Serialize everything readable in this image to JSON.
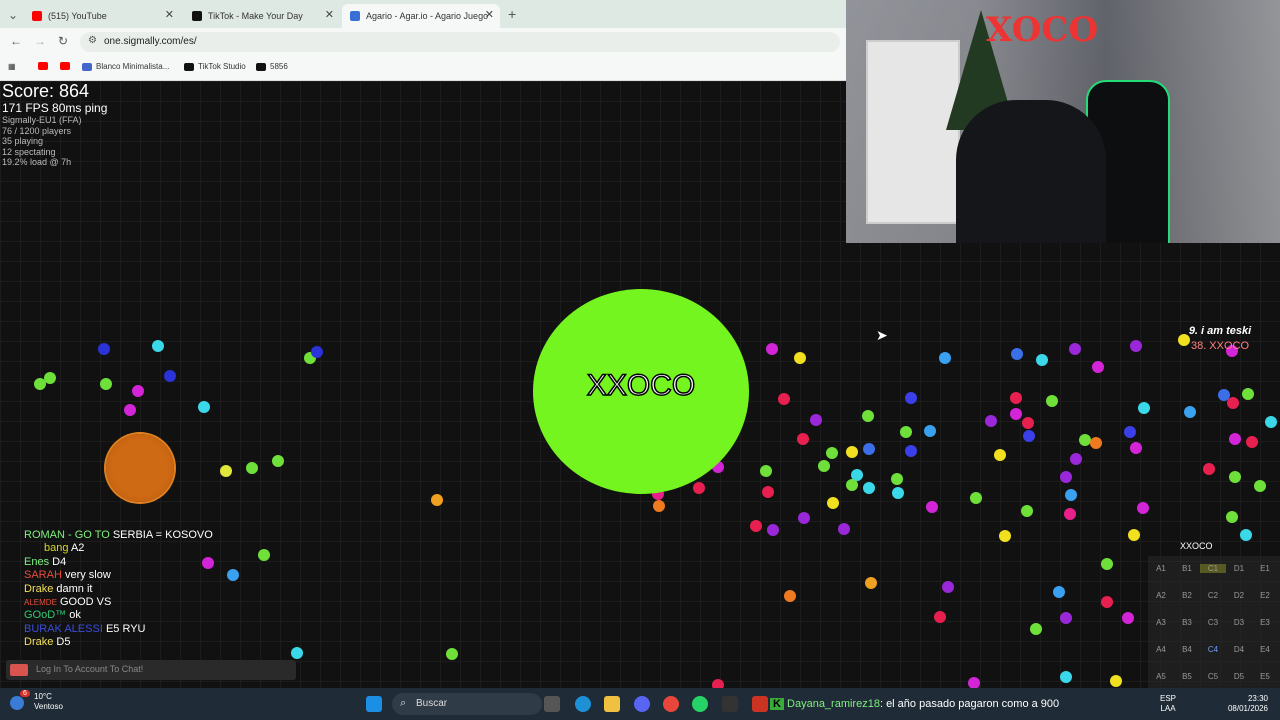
{
  "browser": {
    "tabs": [
      {
        "title": "(515) YouTube",
        "icon": "youtube-icon",
        "color": "#ff0000"
      },
      {
        "title": "TikTok - Make Your Day",
        "icon": "tiktok-icon",
        "color": "#111111"
      },
      {
        "title": "Agario - Agar.io - Agario Juego",
        "icon": "agario-icon",
        "color": "#3a6fd8"
      }
    ],
    "url": "one.sigmally.com/es/",
    "bookmarks": [
      {
        "label": "",
        "icon": "youtube-icon",
        "color": "#ff0000"
      },
      {
        "label": "",
        "icon": "youtube-icon",
        "color": "#ff0000"
      },
      {
        "label": "Blanco Minimalista...",
        "icon": "canva-icon",
        "color": "#4466cc"
      },
      {
        "label": "TikTok Studio",
        "icon": "tiktok-icon",
        "color": "#111111"
      },
      {
        "label": "5856",
        "icon": "tiktok-icon",
        "color": "#111111"
      }
    ]
  },
  "game": {
    "stats": {
      "score": "Score: 864",
      "fps": "171 FPS 80ms ping",
      "server": "Sigmally-EU1 (FFA)",
      "players": "76 / 1200 players",
      "playing": "35 playing",
      "spectating": "12 spectating",
      "load": "19.2% load @ 7h"
    },
    "player_name": "XXOCO",
    "leaderboard": [
      "9. i am teski",
      "38. XXOCO"
    ],
    "chat": [
      {
        "name": "ROMAN - GO TO",
        "name_color": "#7ef07e",
        "msg": "SERBIA = KOSOVO"
      },
      {
        "name": "bang",
        "name_color": "#d6d62b",
        "msg": "A2"
      },
      {
        "name": "Enes",
        "name_color": "#7ef07e",
        "msg": "D4"
      },
      {
        "name": "SARAH",
        "name_color": "#e74c3c",
        "msg": "very slow"
      },
      {
        "name": "Drake",
        "name_color": "#f1e05a",
        "msg": "damn it"
      },
      {
        "name": "ALEMDE",
        "name_color": "#e74c3c",
        "msg": "GOOD VS"
      },
      {
        "name": "GOoD™",
        "name_color": "#2ecc71",
        "msg": "ok"
      },
      {
        "name": "BURAK ALESSI",
        "name_color": "#3a4fd8",
        "msg": "E5 RYU"
      },
      {
        "name": "Drake",
        "name_color": "#f1e05a",
        "msg": "D5"
      }
    ],
    "chat_placeholder": "Log In To Account To Chat!",
    "minimap": {
      "player": "XXOCO",
      "cells": [
        [
          "A1",
          "B1",
          "C1",
          "D1",
          "E1"
        ],
        [
          "A2",
          "B2",
          "C2",
          "D2",
          "E2"
        ],
        [
          "A3",
          "B3",
          "C3",
          "D3",
          "E3"
        ],
        [
          "A4",
          "B4",
          "C4",
          "D4",
          "E4"
        ],
        [
          "A5",
          "B5",
          "C5",
          "D5",
          "E5"
        ]
      ]
    }
  },
  "taskbar": {
    "temp": "10°C",
    "weather": "Ventoso",
    "search_placeholder": "Buscar",
    "ticker_user": "Dayana_ramirez18",
    "ticker_msg": ": el año pasado pagaron como a 900",
    "lang1": "ESP",
    "lang2": "LAA",
    "time": "23:30",
    "date": "08/01/2026",
    "notif_count": "6"
  }
}
